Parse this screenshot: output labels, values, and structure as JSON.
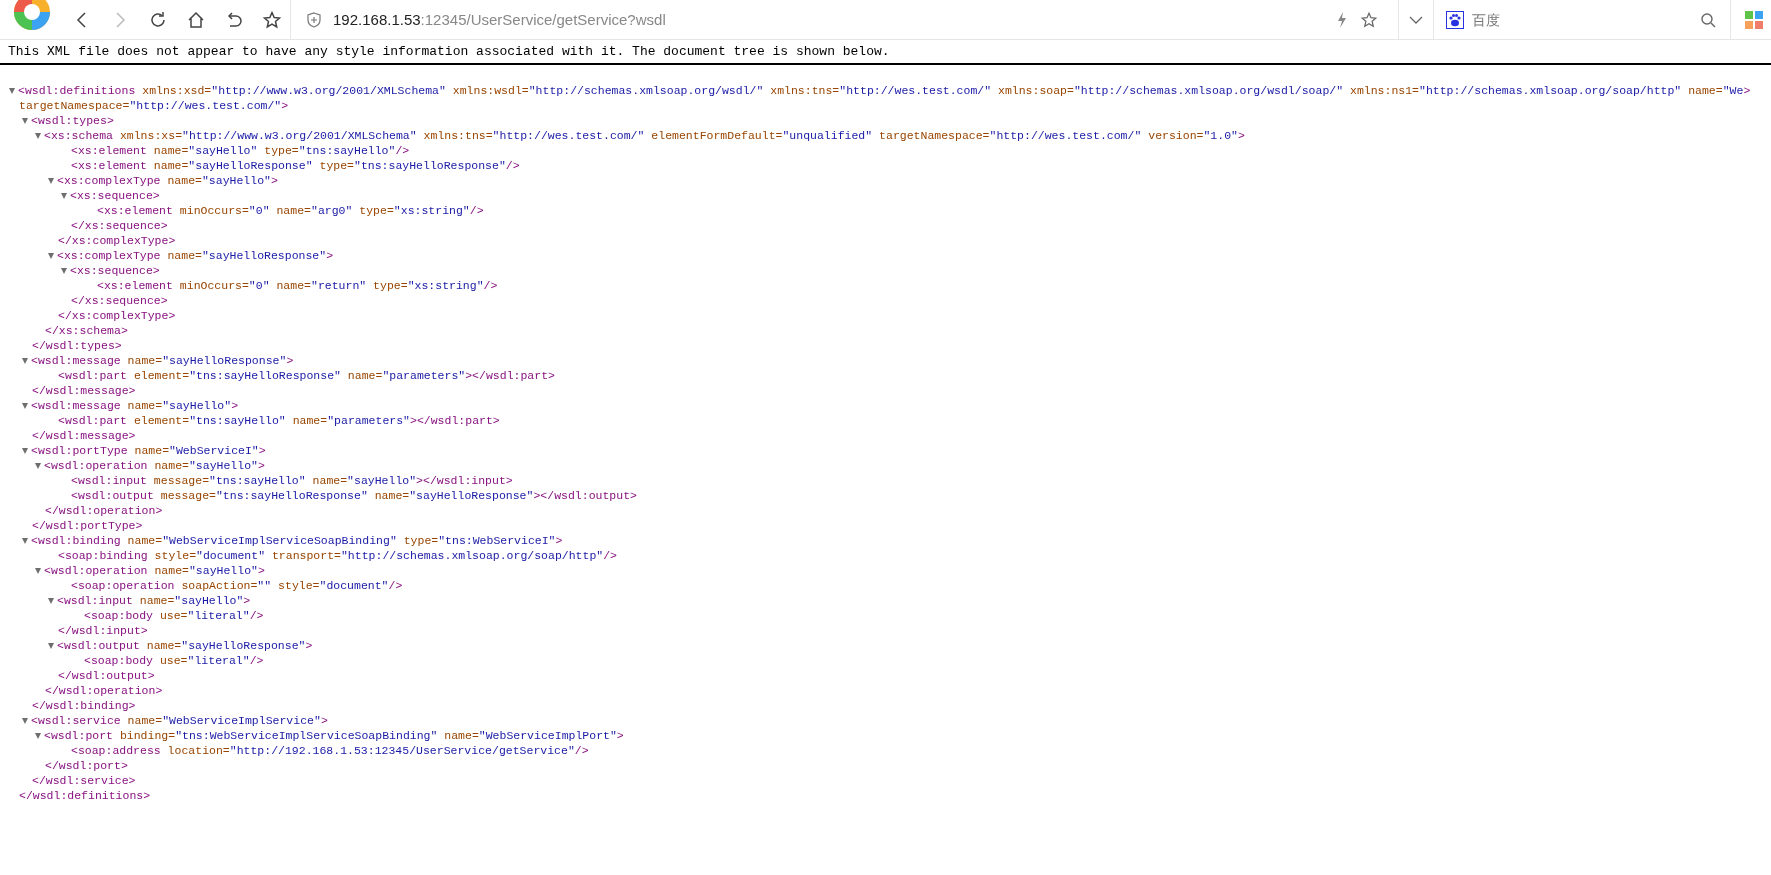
{
  "toolbar": {
    "nav_buttons": [
      {
        "kind": "back",
        "disabled": false
      },
      {
        "kind": "forward",
        "disabled": true
      },
      {
        "kind": "reload",
        "disabled": false
      },
      {
        "kind": "home",
        "disabled": false
      },
      {
        "kind": "undo",
        "disabled": false
      },
      {
        "kind": "bookmark",
        "disabled": false
      }
    ],
    "address": {
      "host": "192.168.1.53",
      "rest": ":12345/UserService/getService?wsdl"
    },
    "search": {
      "placeholder": "百度"
    }
  },
  "info_message": "This XML file does not appear to have any style information associated with it. The document tree is shown below.",
  "document": {
    "start": "<wsdl:definitions",
    "attrs": [
      {
        "name": " xmlns:xsd=",
        "value": "\"http://www.w3.org/2001/XMLSchema\""
      },
      {
        "name": " xmlns:wsdl=",
        "value": "\"http://schemas.xmlsoap.org/wsdl/\""
      },
      {
        "name": " xmlns:tns=",
        "value": "\"http://wes.test.com/\""
      },
      {
        "name": " xmlns:soap=",
        "value": "\"http://schemas.xmlsoap.org/wsdl/soap/\""
      },
      {
        "name": " xmlns:ns1=",
        "value": "\"http://schemas.xmlsoap.org/soap/http\""
      },
      {
        "name": " name=",
        "value": "\"We"
      }
    ],
    "wrapped_attrs": [
      {
        "name": "targetNamespace=",
        "value": "\"http://wes.test.com/\""
      }
    ],
    "end": ">",
    "expanded": true,
    "close": "</wsdl:definitions>",
    "children": [
      {
        "start": "<wsdl:types",
        "end": ">",
        "expanded": true,
        "close": "</wsdl:types>",
        "children": [
          {
            "start": "<xs:schema",
            "attrs": [
              {
                "name": " xmlns:xs=",
                "value": "\"http://www.w3.org/2001/XMLSchema\""
              },
              {
                "name": " xmlns:tns=",
                "value": "\"http://wes.test.com/\""
              },
              {
                "name": " elementFormDefault=",
                "value": "\"unqualified\""
              },
              {
                "name": " targetNamespace=",
                "value": "\"http://wes.test.com/\""
              },
              {
                "name": " version=",
                "value": "\"1.0\""
              }
            ],
            "end": ">",
            "expanded": true,
            "close": "</xs:schema>",
            "children": [
              {
                "start": "<xs:element",
                "attrs": [
                  {
                    "name": " name=",
                    "value": "\"sayHello\""
                  },
                  {
                    "name": " type=",
                    "value": "\"tns:sayHello\""
                  }
                ],
                "end": "/>"
              },
              {
                "start": "<xs:element",
                "attrs": [
                  {
                    "name": " name=",
                    "value": "\"sayHelloResponse\""
                  },
                  {
                    "name": " type=",
                    "value": "\"tns:sayHelloResponse\""
                  }
                ],
                "end": "/>"
              },
              {
                "start": "<xs:complexType",
                "attrs": [
                  {
                    "name": " name=",
                    "value": "\"sayHello\""
                  }
                ],
                "end": ">",
                "expanded": true,
                "close": "</xs:complexType>",
                "children": [
                  {
                    "start": "<xs:sequence",
                    "end": ">",
                    "expanded": true,
                    "close": "</xs:sequence>",
                    "children": [
                      {
                        "start": "<xs:element",
                        "attrs": [
                          {
                            "name": " minOccurs=",
                            "value": "\"0\""
                          },
                          {
                            "name": " name=",
                            "value": "\"arg0\""
                          },
                          {
                            "name": " type=",
                            "value": "\"xs:string\""
                          }
                        ],
                        "end": "/>"
                      }
                    ]
                  }
                ]
              },
              {
                "start": "<xs:complexType",
                "attrs": [
                  {
                    "name": " name=",
                    "value": "\"sayHelloResponse\""
                  }
                ],
                "end": ">",
                "expanded": true,
                "close": "</xs:complexType>",
                "children": [
                  {
                    "start": "<xs:sequence",
                    "end": ">",
                    "expanded": true,
                    "close": "</xs:sequence>",
                    "children": [
                      {
                        "start": "<xs:element",
                        "attrs": [
                          {
                            "name": " minOccurs=",
                            "value": "\"0\""
                          },
                          {
                            "name": " name=",
                            "value": "\"return\""
                          },
                          {
                            "name": " type=",
                            "value": "\"xs:string\""
                          }
                        ],
                        "end": "/>"
                      }
                    ]
                  }
                ]
              }
            ]
          }
        ]
      },
      {
        "start": "<wsdl:message",
        "attrs": [
          {
            "name": " name=",
            "value": "\"sayHelloResponse\""
          }
        ],
        "end": ">",
        "expanded": true,
        "close": "</wsdl:message>",
        "children": [
          {
            "start": "<wsdl:part",
            "attrs": [
              {
                "name": " element=",
                "value": "\"tns:sayHelloResponse\""
              },
              {
                "name": " name=",
                "value": "\"parameters\""
              }
            ],
            "end": "></wsdl:part>"
          }
        ]
      },
      {
        "start": "<wsdl:message",
        "attrs": [
          {
            "name": " name=",
            "value": "\"sayHello\""
          }
        ],
        "end": ">",
        "expanded": true,
        "close": "</wsdl:message>",
        "children": [
          {
            "start": "<wsdl:part",
            "attrs": [
              {
                "name": " element=",
                "value": "\"tns:sayHello\""
              },
              {
                "name": " name=",
                "value": "\"parameters\""
              }
            ],
            "end": "></wsdl:part>"
          }
        ]
      },
      {
        "start": "<wsdl:portType",
        "attrs": [
          {
            "name": " name=",
            "value": "\"WebServiceI\""
          }
        ],
        "end": ">",
        "expanded": true,
        "close": "</wsdl:portType>",
        "children": [
          {
            "start": "<wsdl:operation",
            "attrs": [
              {
                "name": " name=",
                "value": "\"sayHello\""
              }
            ],
            "end": ">",
            "expanded": true,
            "close": "</wsdl:operation>",
            "children": [
              {
                "start": "<wsdl:input",
                "attrs": [
                  {
                    "name": " message=",
                    "value": "\"tns:sayHello\""
                  },
                  {
                    "name": " name=",
                    "value": "\"sayHello\""
                  }
                ],
                "end": "></wsdl:input>"
              },
              {
                "start": "<wsdl:output",
                "attrs": [
                  {
                    "name": " message=",
                    "value": "\"tns:sayHelloResponse\""
                  },
                  {
                    "name": " name=",
                    "value": "\"sayHelloResponse\""
                  }
                ],
                "end": "></wsdl:output>"
              }
            ]
          }
        ]
      },
      {
        "start": "<wsdl:binding",
        "attrs": [
          {
            "name": " name=",
            "value": "\"WebServiceImplServiceSoapBinding\""
          },
          {
            "name": " type=",
            "value": "\"tns:WebServiceI\""
          }
        ],
        "end": ">",
        "expanded": true,
        "close": "</wsdl:binding>",
        "children": [
          {
            "start": "<soap:binding",
            "attrs": [
              {
                "name": " style=",
                "value": "\"document\""
              },
              {
                "name": " transport=",
                "value": "\"http://schemas.xmlsoap.org/soap/http\""
              }
            ],
            "end": "/>"
          },
          {
            "start": "<wsdl:operation",
            "attrs": [
              {
                "name": " name=",
                "value": "\"sayHello\""
              }
            ],
            "end": ">",
            "expanded": true,
            "close": "</wsdl:operation>",
            "children": [
              {
                "start": "<soap:operation",
                "attrs": [
                  {
                    "name": " soapAction=",
                    "value": "\"\""
                  },
                  {
                    "name": " style=",
                    "value": "\"document\""
                  }
                ],
                "end": "/>"
              },
              {
                "start": "<wsdl:input",
                "attrs": [
                  {
                    "name": " name=",
                    "value": "\"sayHello\""
                  }
                ],
                "end": ">",
                "expanded": true,
                "close": "</wsdl:input>",
                "children": [
                  {
                    "start": "<soap:body",
                    "attrs": [
                      {
                        "name": " use=",
                        "value": "\"literal\""
                      }
                    ],
                    "end": "/>"
                  }
                ]
              },
              {
                "start": "<wsdl:output",
                "attrs": [
                  {
                    "name": " name=",
                    "value": "\"sayHelloResponse\""
                  }
                ],
                "end": ">",
                "expanded": true,
                "close": "</wsdl:output>",
                "children": [
                  {
                    "start": "<soap:body",
                    "attrs": [
                      {
                        "name": " use=",
                        "value": "\"literal\""
                      }
                    ],
                    "end": "/>"
                  }
                ]
              }
            ]
          }
        ]
      },
      {
        "start": "<wsdl:service",
        "attrs": [
          {
            "name": " name=",
            "value": "\"WebServiceImplService\""
          }
        ],
        "end": ">",
        "expanded": true,
        "close": "</wsdl:service>",
        "children": [
          {
            "start": "<wsdl:port",
            "attrs": [
              {
                "name": " binding=",
                "value": "\"tns:WebServiceImplServiceSoapBinding\""
              },
              {
                "name": " name=",
                "value": "\"WebServiceImplPort\""
              }
            ],
            "end": ">",
            "expanded": true,
            "close": "</wsdl:port>",
            "children": [
              {
                "start": "<soap:address",
                "attrs": [
                  {
                    "name": " location=",
                    "value": "\"http://192.168.1.53:12345/UserService/getService\""
                  }
                ],
                "end": "/>"
              }
            ]
          }
        ]
      }
    ]
  }
}
